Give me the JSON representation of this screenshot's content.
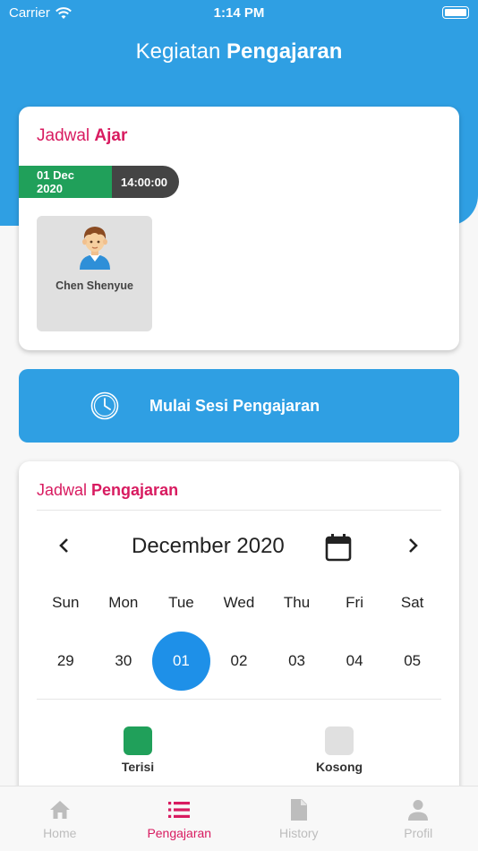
{
  "status_bar": {
    "carrier": "Carrier",
    "time": "1:14 PM"
  },
  "header": {
    "title_regular": "Kegiatan ",
    "title_bold": "Pengajaran"
  },
  "schedule_card": {
    "title_regular": "Jadwal ",
    "title_bold": "Ajar",
    "date": "01 Dec 2020",
    "time": "14:00:00",
    "student": {
      "name": "Chen Shenyue",
      "avatar_icon": "student-avatar-icon"
    }
  },
  "start_button": {
    "label": "Mulai Sesi Pengajaran",
    "icon": "clock-icon"
  },
  "calendar_card": {
    "title_regular": "Jadwal ",
    "title_bold": "Pengajaran",
    "month": "December 2020",
    "weekdays": [
      "Sun",
      "Mon",
      "Tue",
      "Wed",
      "Thu",
      "Fri",
      "Sat"
    ],
    "days": [
      "29",
      "30",
      "01",
      "02",
      "03",
      "04",
      "05"
    ],
    "selected_day": "01",
    "legend": [
      {
        "label": "Terisi",
        "color": "#20a05a"
      },
      {
        "label": "Kosong",
        "color": "#e0e0e0"
      }
    ]
  },
  "bottom_nav": [
    {
      "label": "Home",
      "icon": "home-icon",
      "active": false
    },
    {
      "label": "Pengajaran",
      "icon": "list-icon",
      "active": true
    },
    {
      "label": "History",
      "icon": "document-icon",
      "active": false
    },
    {
      "label": "Profil",
      "icon": "person-icon",
      "active": false
    }
  ],
  "colors": {
    "primary": "#2f9fe3",
    "accent": "#d81b60",
    "filled": "#20a05a",
    "selected_day": "#1e90e8"
  }
}
